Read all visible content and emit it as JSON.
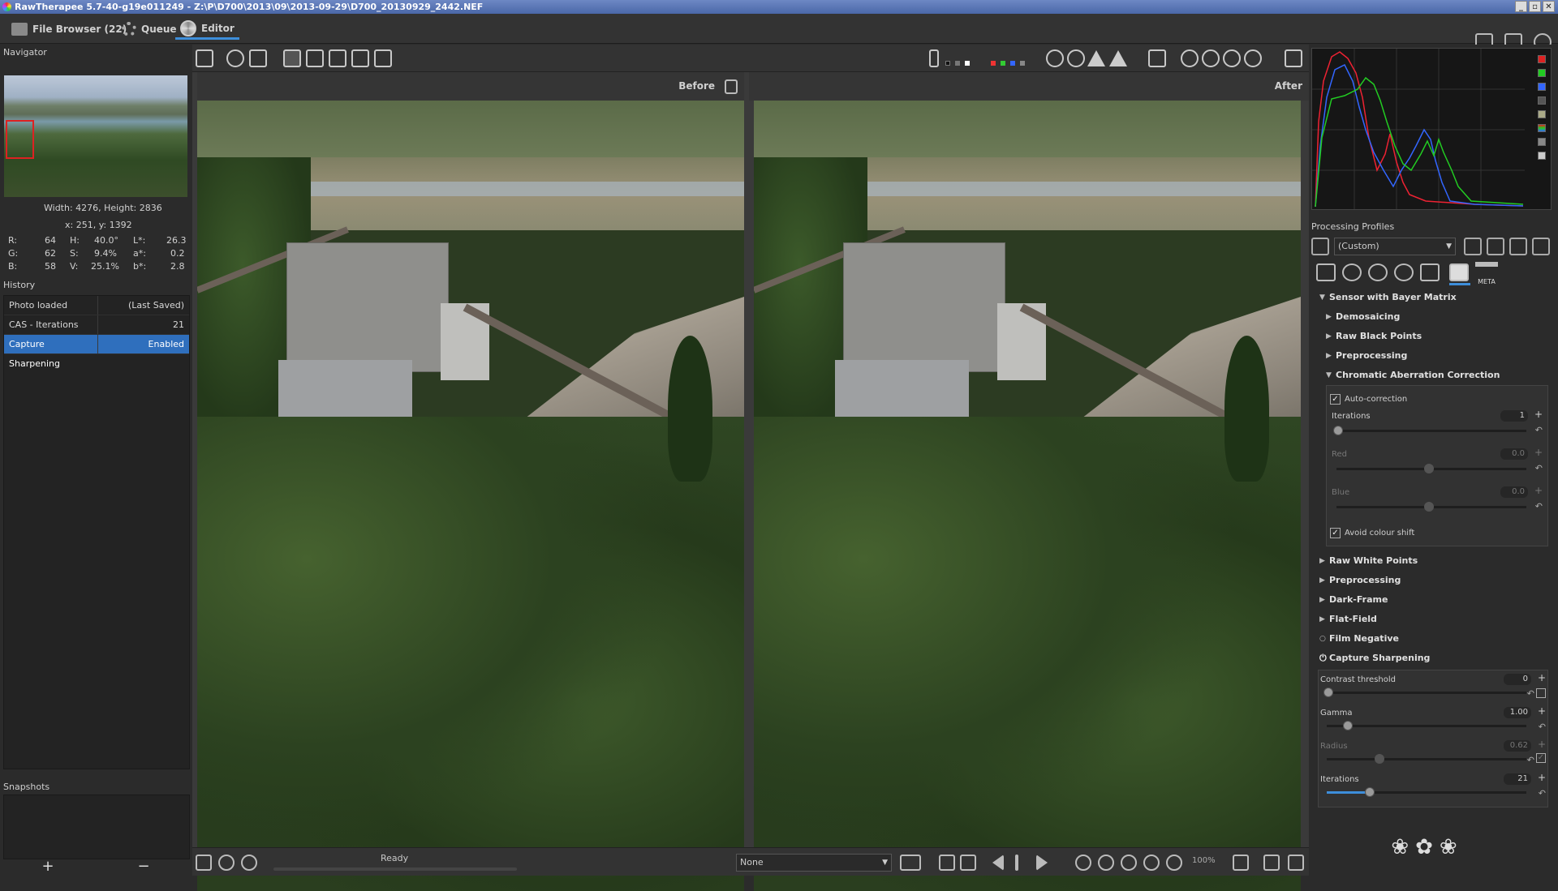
{
  "window": {
    "title": "RawTherapee 5.7-40-g19e011249 - Z:\\P\\D700\\2013\\09\\2013-09-29\\D700_20130929_2442.NEF"
  },
  "tabs": [
    {
      "label": "File Browser (22)"
    },
    {
      "label": "Queue"
    },
    {
      "label": "Editor"
    }
  ],
  "navigator": {
    "title": "Navigator",
    "size": "Width: 4276, Height: 2836",
    "coords": "x: 251, y: 1392",
    "rgb": [
      {
        "k": "R:",
        "v": "64"
      },
      {
        "k": "G:",
        "v": "62"
      },
      {
        "k": "B:",
        "v": "58"
      }
    ],
    "hsv": [
      {
        "k": "H:",
        "v": "40.0°"
      },
      {
        "k": "S:",
        "v": "9.4%"
      },
      {
        "k": "V:",
        "v": "25.1%"
      }
    ],
    "lab": [
      {
        "k": "L*:",
        "v": "26.3"
      },
      {
        "k": "a*:",
        "v": "0.2"
      },
      {
        "k": "b*:",
        "v": "2.8"
      }
    ]
  },
  "history": {
    "title": "History",
    "rows": [
      {
        "name": "Photo loaded",
        "value": "(Last Saved)"
      },
      {
        "name": "CAS - Iterations",
        "value": "21"
      },
      {
        "name": "Capture Sharpening",
        "value": "Enabled"
      }
    ]
  },
  "snapshots": {
    "title": "Snapshots",
    "add": "+",
    "remove": "−"
  },
  "viewer": {
    "before_label": "Before",
    "after_label": "After"
  },
  "status": {
    "text": "Ready",
    "preview_select": "None",
    "zoom": "100%"
  },
  "profiles": {
    "title": "Processing Profiles",
    "current": "(Custom)"
  },
  "tooltabs": {
    "meta_label": "META"
  },
  "panel": {
    "sensor": "Sensor with Bayer Matrix",
    "sub_top": [
      "Demosaicing",
      "Raw Black Points",
      "Preprocessing"
    ],
    "ca": {
      "title": "Chromatic Aberration Correction",
      "auto_correction": "Auto-correction",
      "iterations": {
        "label": "Iterations",
        "value": "1"
      },
      "red": {
        "label": "Red",
        "value": "0.0"
      },
      "blue": {
        "label": "Blue",
        "value": "0.0"
      },
      "avoid_shift": "Avoid colour shift"
    },
    "sections": [
      "Raw White Points",
      "Preprocessing",
      "Dark-Frame",
      "Flat-Field",
      "Film Negative"
    ],
    "capture": {
      "title": "Capture Sharpening",
      "contrast": {
        "label": "Contrast threshold",
        "value": "0"
      },
      "gamma": {
        "label": "Gamma",
        "value": "1.00"
      },
      "radius": {
        "label": "Radius",
        "value": "0.62"
      },
      "iterations": {
        "label": "Iterations",
        "value": "21"
      }
    }
  },
  "colors": {
    "accent": "#3d8edb",
    "selection": "#2f6fbd"
  }
}
